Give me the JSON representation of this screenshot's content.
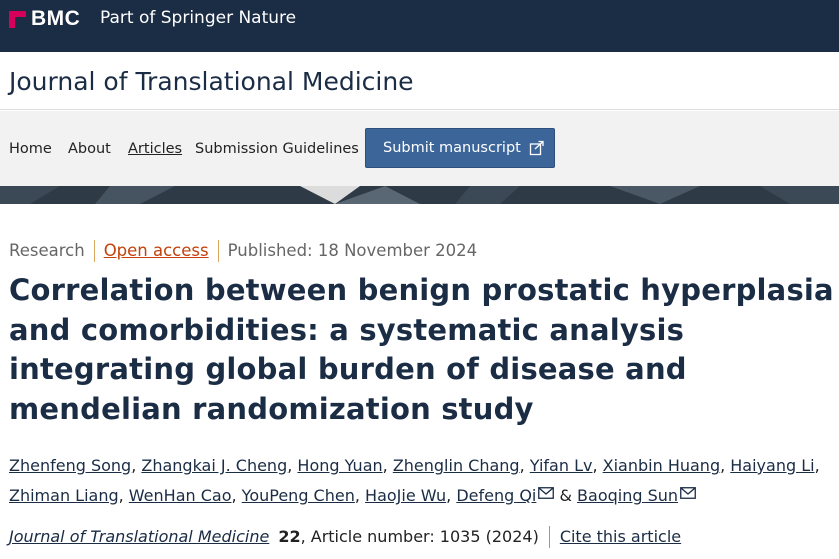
{
  "brand": {
    "logo_text": "BMC",
    "tagline": "Part of Springer Nature"
  },
  "journal": {
    "title": "Journal of Translational Medicine"
  },
  "nav": {
    "items": [
      "Home",
      "About",
      "Articles",
      "Submission Guidelines"
    ],
    "active": "Articles",
    "submit_label": "Submit manuscript"
  },
  "article": {
    "type": "Research",
    "access": "Open access",
    "published": "Published: 18 November 2024",
    "title": "Correlation between benign prostatic hyperplasia and comorbidities: a systematic analysis integrating global burden of disease and mendelian randomization study",
    "authors": [
      "Zhenfeng Song",
      "Zhangkai J. Cheng",
      "Hong Yuan",
      "Zhenglin Chang",
      "Yifan Lv",
      "Xianbin Huang",
      "Haiyang Li",
      "Zhiman Liang",
      "WenHan Cao",
      "YouPeng Chen",
      "HaoJie Wu",
      "Defeng Qi",
      "Baoqing Sun"
    ],
    "author_conjunction": "&",
    "citation": {
      "journal": "Journal of Translational Medicine",
      "volume": "22",
      "article_number": ", Article number: 1035 (2024)",
      "cite_label": "Cite this article"
    }
  },
  "colors": {
    "brand_bar": "#1b2c45",
    "accent_pink": "#d6005a",
    "submit_button": "#3c6599",
    "open_access": "#c2410c"
  }
}
